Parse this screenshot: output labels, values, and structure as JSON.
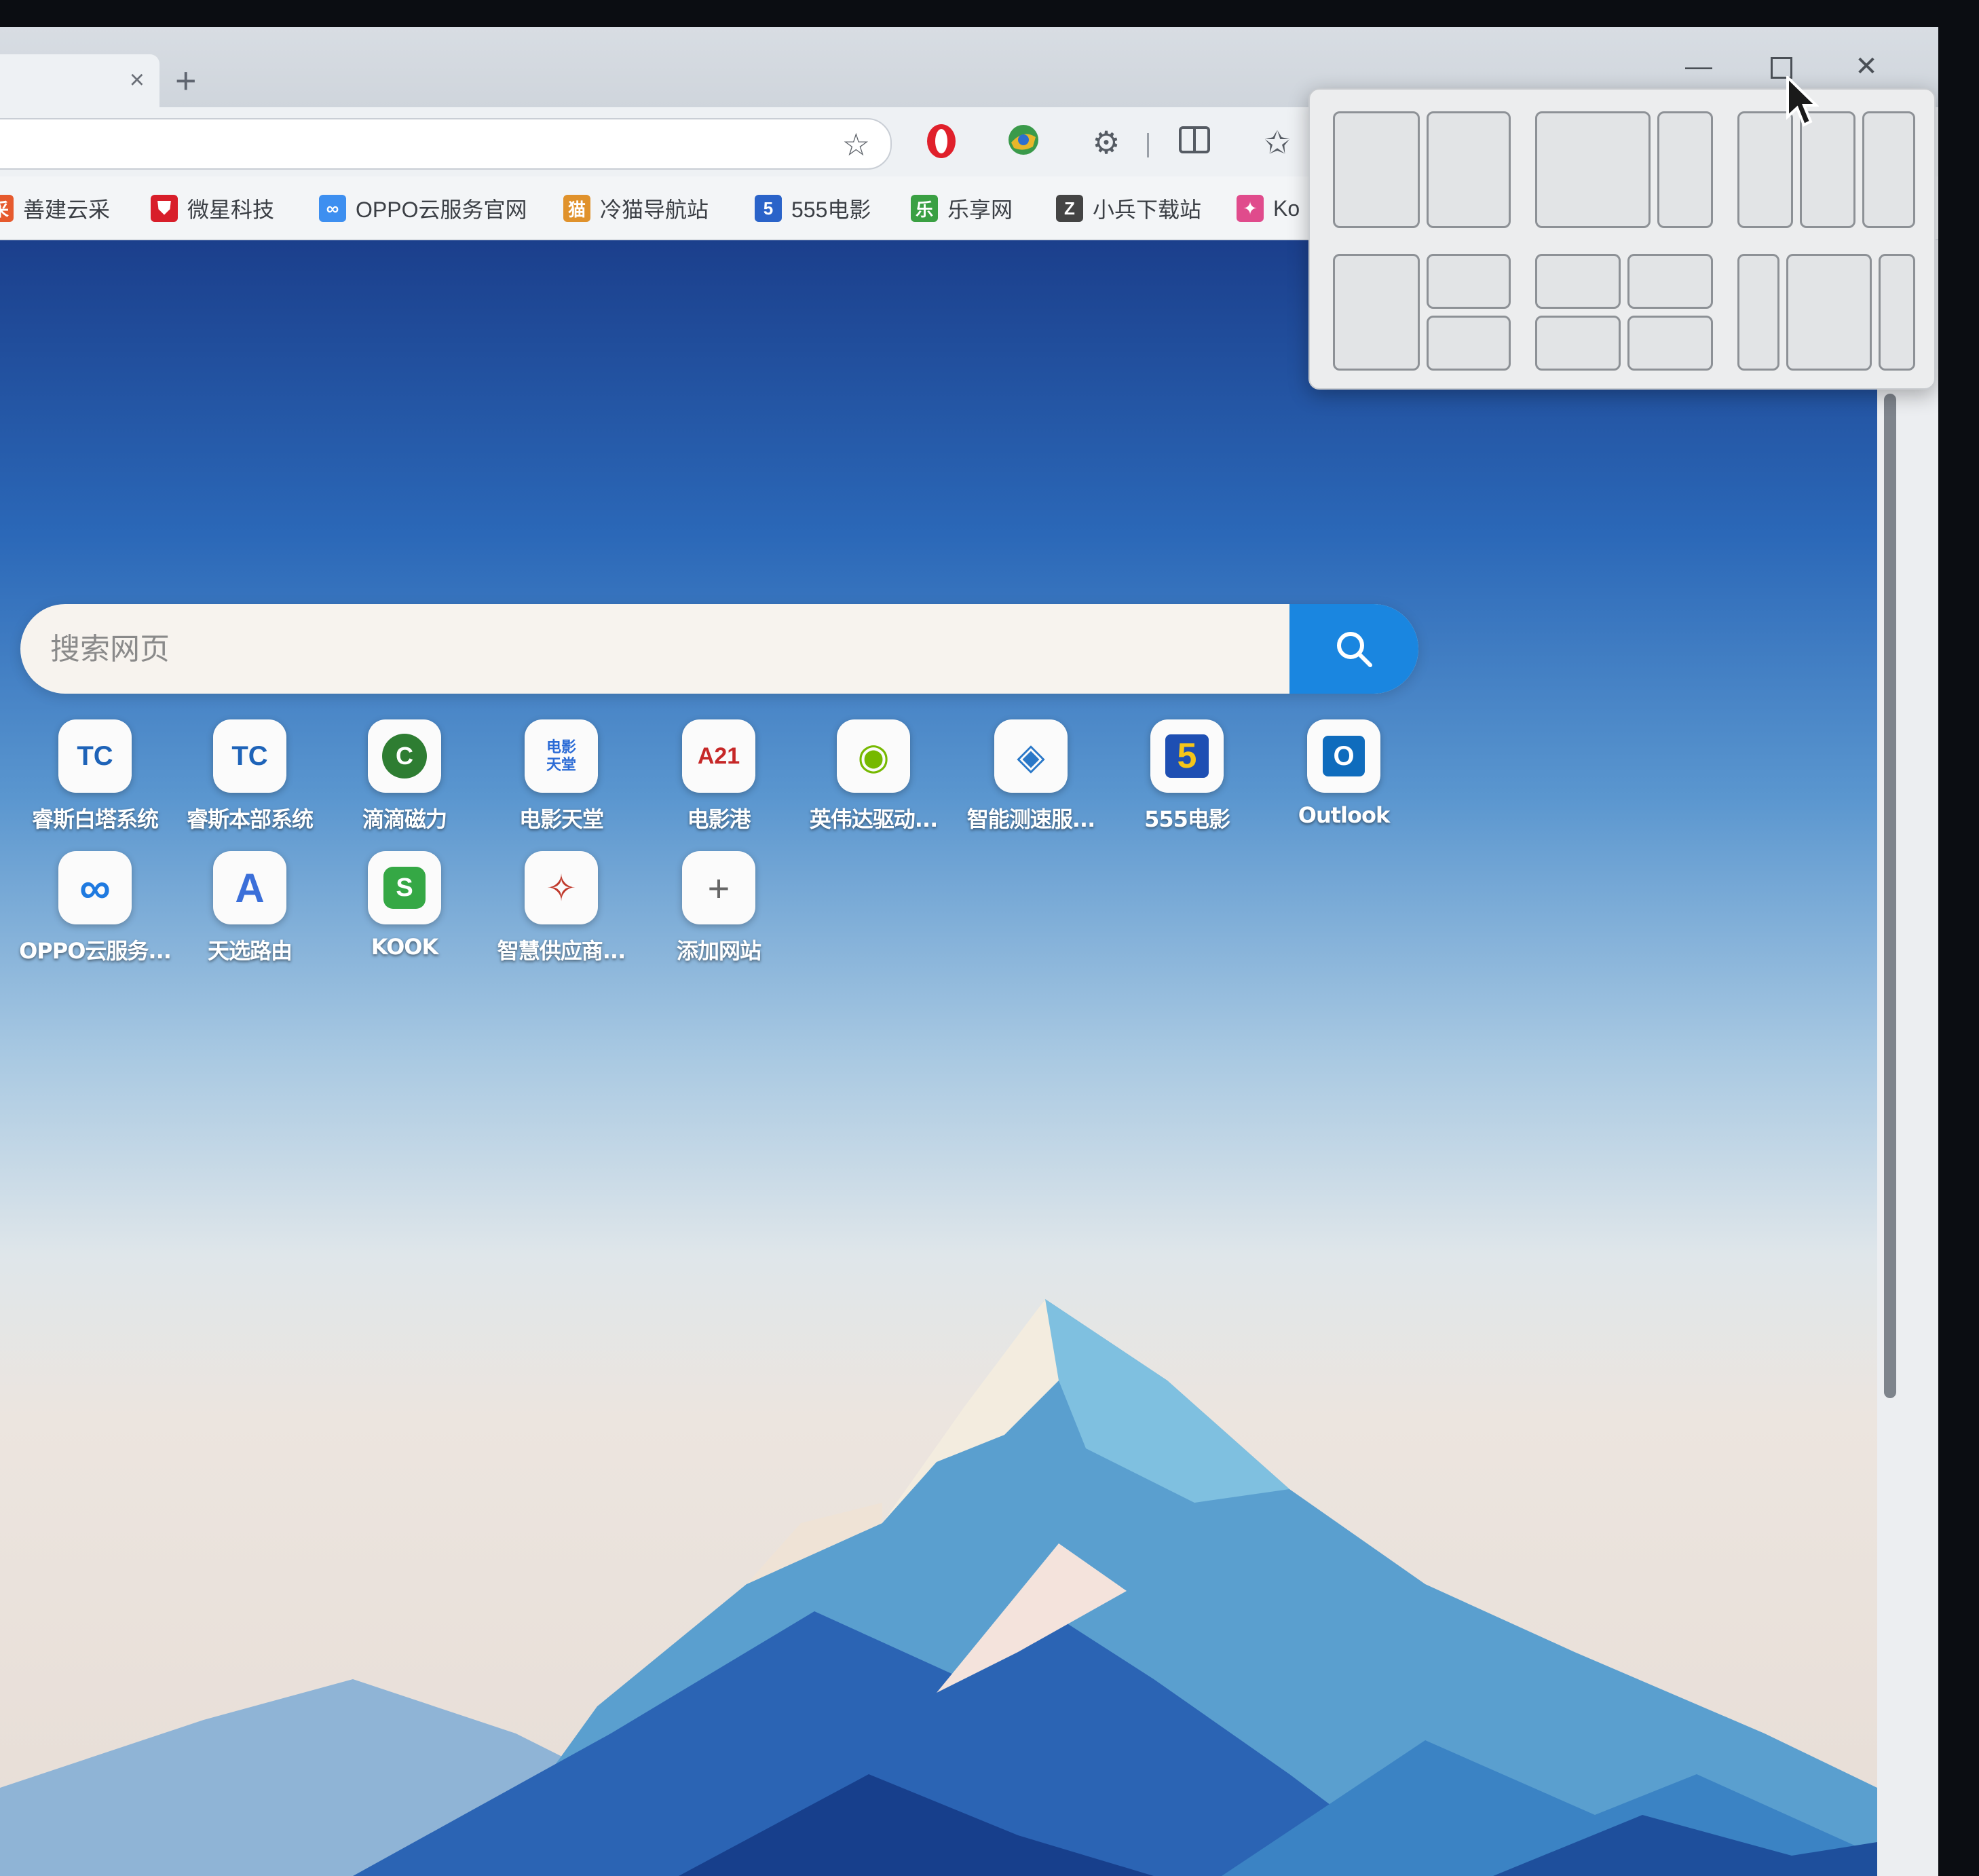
{
  "tab": {
    "close_glyph": "×"
  },
  "new_tab_glyph": "+",
  "window_controls": {
    "minimize_glyph": "—",
    "close_glyph": "✕"
  },
  "bookmarks": [
    {
      "label": "善建云采",
      "icon": "bookmark-shanjian-icon",
      "color": "#e65a2e",
      "glyph": "采"
    },
    {
      "label": "微星科技",
      "icon": "msi-shield-icon",
      "color": "#d81e2a",
      "glyph": "⛊"
    },
    {
      "label": "OPPO云服务官网",
      "icon": "oppo-cloud-icon",
      "color": "#3d8ff0",
      "glyph": "∞"
    },
    {
      "label": "冷猫导航站",
      "icon": "cat-icon",
      "color": "#e0922c",
      "glyph": "猫"
    },
    {
      "label": "555电影",
      "icon": "film-555-icon",
      "color": "#2a63c9",
      "glyph": "5"
    },
    {
      "label": "乐享网",
      "icon": "lexiang-icon",
      "color": "#3aa043",
      "glyph": "乐"
    },
    {
      "label": "小兵下载站",
      "icon": "xiaobing-icon",
      "color": "#444444",
      "glyph": "Z"
    },
    {
      "label": "Ko",
      "icon": "pinwheel-icon",
      "color": "#e04b8c",
      "glyph": "✦"
    }
  ],
  "search": {
    "placeholder": "搜索网页"
  },
  "tiles": [
    {
      "label": "睿斯白塔系统",
      "glyph": "TC",
      "fg": "#1e63b8"
    },
    {
      "label": "睿斯本部系统",
      "glyph": "TC",
      "fg": "#1e63b8"
    },
    {
      "label": "滴滴磁力",
      "glyph": "C",
      "fg": "#2e7d32"
    },
    {
      "label": "电影天堂",
      "glyph": "电影天堂",
      "fg": "#2b6bd6"
    },
    {
      "label": "电影港",
      "glyph": "A21",
      "fg": "#c62828"
    },
    {
      "label": "英伟达驱动...",
      "glyph": "◉",
      "fg": "#76b900"
    },
    {
      "label": "智能测速服...",
      "glyph": "◈",
      "fg": "#2a78c8"
    },
    {
      "label": "555电影",
      "glyph": "5",
      "fg": "#1e4fb3"
    },
    {
      "label": "Outlook",
      "glyph": "O",
      "fg": "#0f6cbd"
    },
    {
      "label": "OPPO云服务...",
      "glyph": "∞",
      "fg": "#1f7ae0"
    },
    {
      "label": "天选路由",
      "glyph": "A",
      "fg": "#3b6fd9"
    },
    {
      "label": "KOOK",
      "glyph": "S",
      "fg": "#35a845"
    },
    {
      "label": "智慧供应商...",
      "glyph": "✧",
      "fg": "#c0392b"
    },
    {
      "label": "添加网站",
      "glyph": "+",
      "fg": "#666666"
    }
  ]
}
